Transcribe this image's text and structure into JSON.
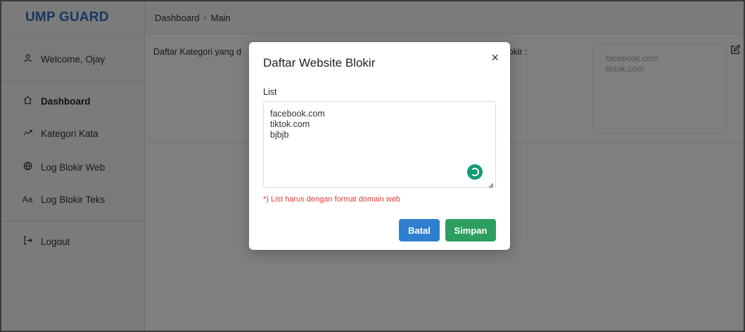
{
  "sidebar": {
    "brand": "UMP GUARD",
    "items": [
      {
        "label": "Welcome, Ojay",
        "icon": "user-icon"
      },
      {
        "label": "Dashboard",
        "icon": "home-icon"
      },
      {
        "label": "Kategori Kata",
        "icon": "trend-icon"
      },
      {
        "label": "Log Blokir Web",
        "icon": "globe-icon"
      },
      {
        "label": "Log Blokir Teks",
        "icon": "text-icon"
      },
      {
        "label": "Logout",
        "icon": "logout-icon"
      }
    ]
  },
  "header": {
    "crumb_1": "Dashboard",
    "crumb_2": "Main"
  },
  "content": {
    "label_left": "Daftar Kategori yang d",
    "label_right": "e Blokir :",
    "bg_textarea": "facebook.com\ntiktok.com"
  },
  "modal": {
    "title": "Daftar Website Blokir",
    "close": "×",
    "field_label": "List",
    "textarea_value": "facebook.com\ntiktok.com\nbjbjb",
    "hint": "*) List harus dengan format domain web",
    "cancel_label": "Batal",
    "save_label": "Simpan"
  },
  "colors": {
    "brand": "#2c6fc2",
    "cancel": "#2f7fd0",
    "save": "#2c9e5e",
    "hint": "#e23b3b",
    "spinner": "#129a73"
  }
}
